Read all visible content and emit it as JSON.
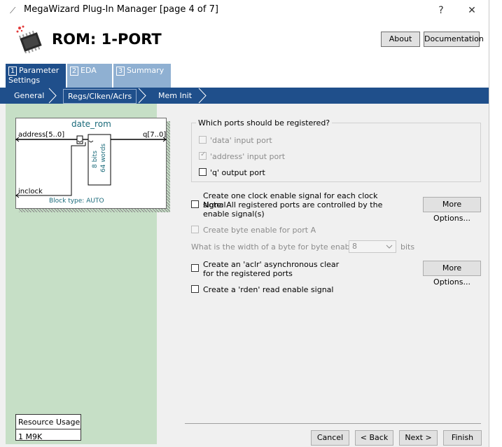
{
  "window": {
    "title": "MegaWizard Plug-In Manager [page 4 of 7]",
    "help_glyph": "?",
    "close_glyph": "✕"
  },
  "header": {
    "title": "ROM: 1-PORT",
    "about_label": "About",
    "documentation_label": "Documentation"
  },
  "tabs": [
    {
      "num": "1",
      "label": "Parameter Settings",
      "active": true
    },
    {
      "num": "2",
      "label": "EDA",
      "active": false
    },
    {
      "num": "3",
      "label": "Summary",
      "active": false
    }
  ],
  "subnav": [
    {
      "label": "General"
    },
    {
      "label": "Regs/Clken/Aclrs",
      "selected": true
    },
    {
      "label": "Mem Init"
    }
  ],
  "block": {
    "name": "date_rom",
    "address_port": "address[5..0]",
    "output_port": "q[7..0]",
    "clock_port": "inclock",
    "memory_bits": "8 bits",
    "memory_words": "64 words",
    "block_type": "Block type: AUTO"
  },
  "resource": {
    "title": "Resource Usage",
    "value": "1 M9K"
  },
  "options": {
    "group_title": "Which ports should be registered?",
    "data_port": "'data' input port",
    "address_port": "'address' input port",
    "q_port": "'q' output port",
    "clock_enable": "Create one clock enable signal for each clock signal.",
    "clock_enable_note": "Note: All registered ports are controlled by the enable signal(s)",
    "byte_enable": "Create byte enable for port A",
    "byte_width_q": "What is the width of a byte for byte enables?",
    "byte_width_value": "8",
    "byte_width_unit": "bits",
    "aclr": "Create an 'aclr' asynchronous clear for the registered ports",
    "rden": "Create a 'rden' read enable signal",
    "more_options_label": "More Options..."
  },
  "footer": {
    "cancel": "Cancel",
    "back": "< Back",
    "next": "Next >",
    "finish": "Finish"
  },
  "colors": {
    "tab_active": "#1f4f8b",
    "tab_inactive": "#8fb0d2",
    "left_pane": "#c6dfc6"
  }
}
